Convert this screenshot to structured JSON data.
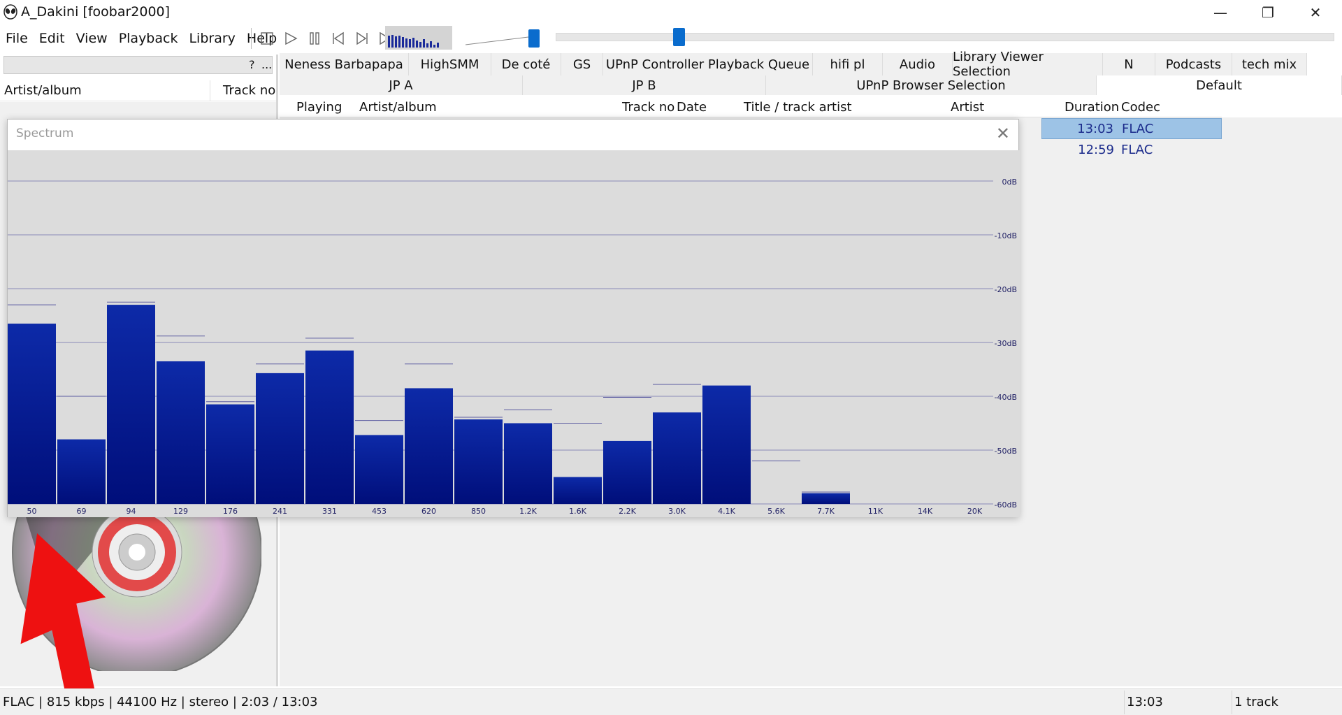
{
  "window": {
    "title": "A_Dakini  [foobar2000]"
  },
  "menu": [
    "File",
    "Edit",
    "View",
    "Playback",
    "Library",
    "Help"
  ],
  "toolbar": [
    "stop-icon",
    "play-icon",
    "pause-icon",
    "previous-icon",
    "next-icon",
    "random-icon"
  ],
  "search": {
    "help": "?",
    "more": "..."
  },
  "left_columns": {
    "artist": "Artist/album",
    "track": "Track no"
  },
  "tabs_row1": [
    "Neness Barbapapa",
    "HighSMM",
    "De coté",
    "GS",
    "UPnP Controller Playback Queue",
    "hifi pl",
    "Audio",
    "Library Viewer Selection",
    "N",
    "Podcasts",
    "tech mix"
  ],
  "tabs_row2": [
    "JP A",
    "JP B",
    "UPnP Browser Selection",
    "Default"
  ],
  "playlist_columns": {
    "playing": "Playing",
    "artist": "Artist/album",
    "track": "Track no",
    "date": "Date",
    "title": "Title / track artist",
    "track_artist": "Artist",
    "duration": "Duration",
    "codec": "Codec"
  },
  "playlist_rows": [
    {
      "duration": "13:03",
      "codec": "FLAC",
      "selected": true
    },
    {
      "duration": "12:59",
      "codec": "FLAC",
      "selected": false
    }
  ],
  "status": {
    "info": "FLAC | 815 kbps | 44100 Hz | stereo | 2:03 / 13:03",
    "total": "13:03",
    "count": "1 track"
  },
  "spectrum": {
    "title": "Spectrum"
  },
  "chart_data": {
    "type": "bar",
    "categories": [
      "50",
      "69",
      "94",
      "129",
      "176",
      "241",
      "331",
      "453",
      "620",
      "850",
      "1.2K",
      "1.6K",
      "2.2K",
      "3.0K",
      "4.1K",
      "5.6K",
      "7.7K",
      "11K",
      "14K",
      "20K"
    ],
    "series": [
      {
        "values": [
          -26.5,
          -48,
          -23,
          -33.5,
          -41.5,
          -35.7,
          -31.5,
          -47.2,
          -38.5,
          -44.3,
          -45,
          -55,
          -48.3,
          -43,
          -38,
          -60,
          -58,
          -60,
          -60,
          -60
        ]
      },
      {
        "values": [
          -23,
          -40,
          -22.5,
          -28.8,
          -41,
          -34,
          -29.2,
          -44.5,
          -34,
          -43.9,
          -42.5,
          -45,
          -40.2,
          -37.8,
          -60,
          -52,
          -57.8,
          -60,
          -60,
          -60
        ]
      }
    ],
    "y_ticks": [
      "0dB",
      "-10dB",
      "-20dB",
      "-30dB",
      "-40dB",
      "-50dB",
      "-60dB"
    ],
    "ylim": [
      -60,
      0
    ],
    "grid": true,
    "colors": {
      "bar_top": "#0d2aa8",
      "bar_bottom": "#000e7a",
      "grid": "#8a8ab8",
      "background": "#dcdcdc"
    }
  }
}
